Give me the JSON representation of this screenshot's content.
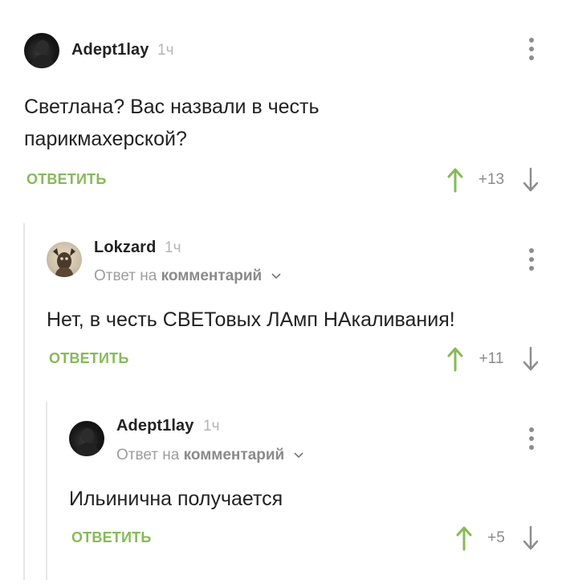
{
  "comments": [
    {
      "author": "Adept1lay",
      "time": "1ч",
      "text_lines": [
        "Светлана? Вас назвали в честь",
        "парикмахерской?"
      ],
      "reply_label": "ОТВЕТИТЬ",
      "score": "+13"
    },
    {
      "author": "Lokzard",
      "time": "1ч",
      "reply_prefix": "Ответ на",
      "reply_target": "комментарий",
      "text_lines": [
        "Нет, в честь СВЕТовых ЛАмп НАкаливания!"
      ],
      "reply_label": "ОТВЕТИТЬ",
      "score": "+11"
    },
    {
      "author": "Adept1lay",
      "time": "1ч",
      "reply_prefix": "Ответ на",
      "reply_target": "комментарий",
      "text_lines": [
        "Ильинична получается"
      ],
      "reply_label": "ОТВЕТИТЬ",
      "score": "+5"
    }
  ],
  "colors": {
    "accent_green": "#87b959",
    "thread_line": "#e6e6e6"
  },
  "icons": {
    "upvote": "arrow-up-icon",
    "downvote": "arrow-down-icon",
    "menu": "kebab-menu-icon",
    "reply_expand": "chevron-down-icon"
  }
}
